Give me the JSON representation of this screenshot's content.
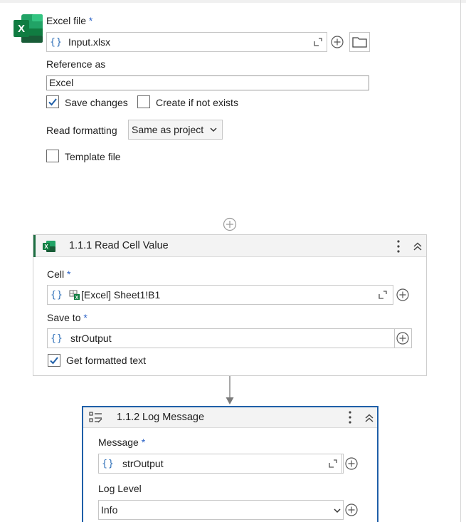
{
  "excel_scope": {
    "file_label": "Excel file",
    "file_value": "Input.xlsx",
    "reference_label": "Reference as",
    "reference_value": "Excel",
    "save_changes_label": "Save changes",
    "save_changes_checked": true,
    "create_if_not_exists_label": "Create if not exists",
    "create_if_not_exists_checked": false,
    "read_formatting_label": "Read formatting",
    "read_formatting_value": "Same as project",
    "template_file_label": "Template file",
    "template_file_checked": false
  },
  "read_cell_value": {
    "number": "1.1.1",
    "title": "Read Cell Value",
    "cell_label": "Cell",
    "cell_value": "[Excel] Sheet1!B1",
    "save_to_label": "Save to",
    "save_to_value": "strOutput",
    "formatted_label": "Get formatted text",
    "formatted_checked": true
  },
  "log_message": {
    "number": "1.1.2",
    "title": "Log Message",
    "message_label": "Message",
    "message_value": "strOutput",
    "level_label": "Log Level",
    "level_value": "Info"
  },
  "required_mark": "*",
  "expression_glyph": "{}",
  "colors": {
    "excel_green": "#1d6f42",
    "accent_blue": "#1f5fa8",
    "required": "#2b62c7"
  }
}
